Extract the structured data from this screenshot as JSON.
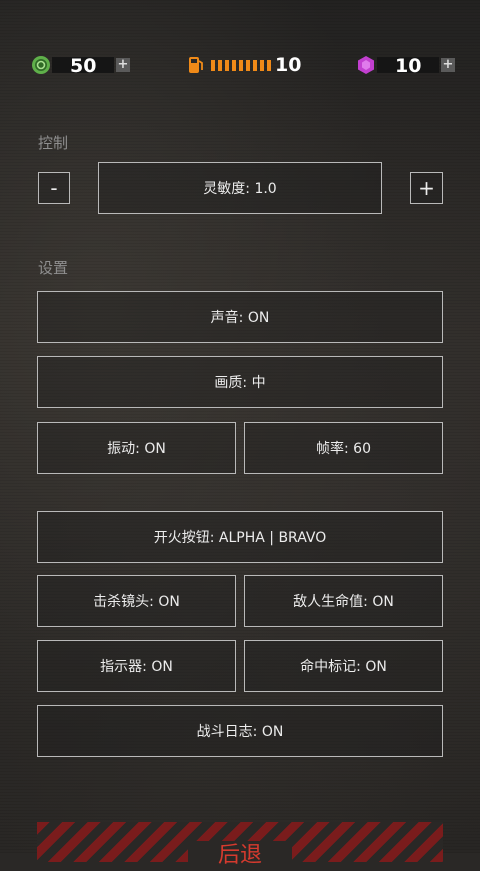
{
  "resources": {
    "coins": {
      "value": "50",
      "icon": "coin-icon",
      "color": "#5fb04a"
    },
    "fuel": {
      "value": "10",
      "icon": "fuel-icon",
      "color": "#f08a18",
      "level": 1.0
    },
    "gems": {
      "value": "10",
      "icon": "gem-icon",
      "color": "#c23fd0"
    },
    "add_symbol": "+"
  },
  "controls": {
    "section_label": "控制",
    "minus_label": "-",
    "plus_label": "+",
    "sensitivity_label": "灵敏度: 1.0"
  },
  "settings": {
    "section_label": "设置",
    "sound": "声音: ON",
    "quality": "画质: 中",
    "vibration": "振动: ON",
    "framerate": "帧率: 60",
    "fire_button": "开火按钮: ALPHA | BRAVO",
    "kill_cam": "击杀镜头: ON",
    "enemy_health": "敌人生命值: ON",
    "indicator": "指示器: ON",
    "hit_marker": "命中标记: ON",
    "combat_log": "战斗日志: ON"
  },
  "retreat": {
    "label": "后退",
    "color": "#d63a2e"
  }
}
